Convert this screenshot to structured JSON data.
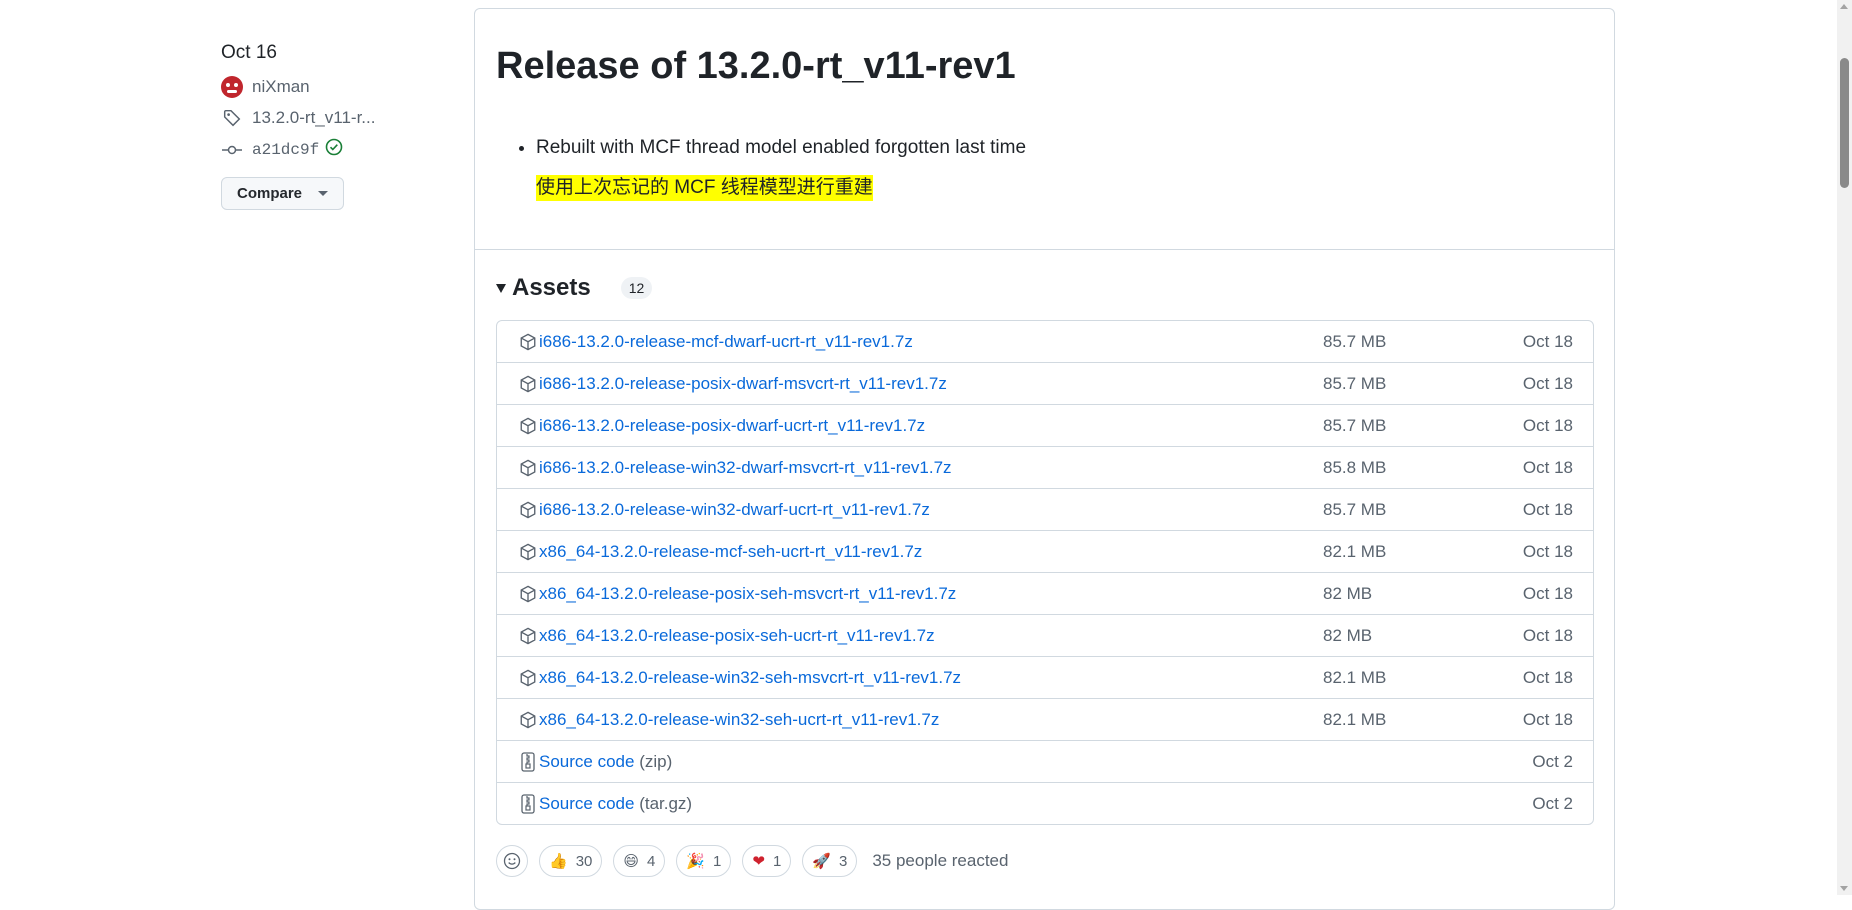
{
  "meta": {
    "date": "Oct 16",
    "author": "niXman",
    "tag": "13.2.0-rt_v11-r...",
    "commit": "a21dc9f",
    "compare_label": "Compare"
  },
  "release": {
    "title": "Release of 13.2.0-rt_v11-rev1",
    "note_en": "Rebuilt with MCF thread model enabled forgotten last time",
    "note_zh": "使用上次忘记的 MCF 线程模型进行重建"
  },
  "assets": {
    "title": "Assets",
    "count": "12",
    "files": [
      {
        "name": "i686-13.2.0-release-mcf-dwarf-ucrt-rt_v11-rev1.7z",
        "size": "85.7 MB",
        "date": "Oct 18"
      },
      {
        "name": "i686-13.2.0-release-posix-dwarf-msvcrt-rt_v11-rev1.7z",
        "size": "85.7 MB",
        "date": "Oct 18"
      },
      {
        "name": "i686-13.2.0-release-posix-dwarf-ucrt-rt_v11-rev1.7z",
        "size": "85.7 MB",
        "date": "Oct 18"
      },
      {
        "name": "i686-13.2.0-release-win32-dwarf-msvcrt-rt_v11-rev1.7z",
        "size": "85.8 MB",
        "date": "Oct 18"
      },
      {
        "name": "i686-13.2.0-release-win32-dwarf-ucrt-rt_v11-rev1.7z",
        "size": "85.7 MB",
        "date": "Oct 18"
      },
      {
        "name": "x86_64-13.2.0-release-mcf-seh-ucrt-rt_v11-rev1.7z",
        "size": "82.1 MB",
        "date": "Oct 18"
      },
      {
        "name": "x86_64-13.2.0-release-posix-seh-msvcrt-rt_v11-rev1.7z",
        "size": "82 MB",
        "date": "Oct 18"
      },
      {
        "name": "x86_64-13.2.0-release-posix-seh-ucrt-rt_v11-rev1.7z",
        "size": "82 MB",
        "date": "Oct 18"
      },
      {
        "name": "x86_64-13.2.0-release-win32-seh-msvcrt-rt_v11-rev1.7z",
        "size": "82.1 MB",
        "date": "Oct 18"
      },
      {
        "name": "x86_64-13.2.0-release-win32-seh-ucrt-rt_v11-rev1.7z",
        "size": "82.1 MB",
        "date": "Oct 18"
      }
    ],
    "source": [
      {
        "label": "Source code",
        "ext": "(zip)",
        "date": "Oct 2"
      },
      {
        "label": "Source code",
        "ext": "(tar.gz)",
        "date": "Oct 2"
      }
    ]
  },
  "reactions": {
    "items": [
      {
        "icon": "thumbs-up-icon",
        "emoji": "👍",
        "count": "30"
      },
      {
        "icon": "laugh-icon",
        "emoji": "😄",
        "count": "4"
      },
      {
        "icon": "hooray-icon",
        "emoji": "🎉",
        "count": "1"
      },
      {
        "icon": "heart-icon",
        "emoji": "❤",
        "count": "1"
      },
      {
        "icon": "rocket-icon",
        "emoji": "🚀",
        "count": "3"
      }
    ],
    "summary": "35 people reacted"
  }
}
